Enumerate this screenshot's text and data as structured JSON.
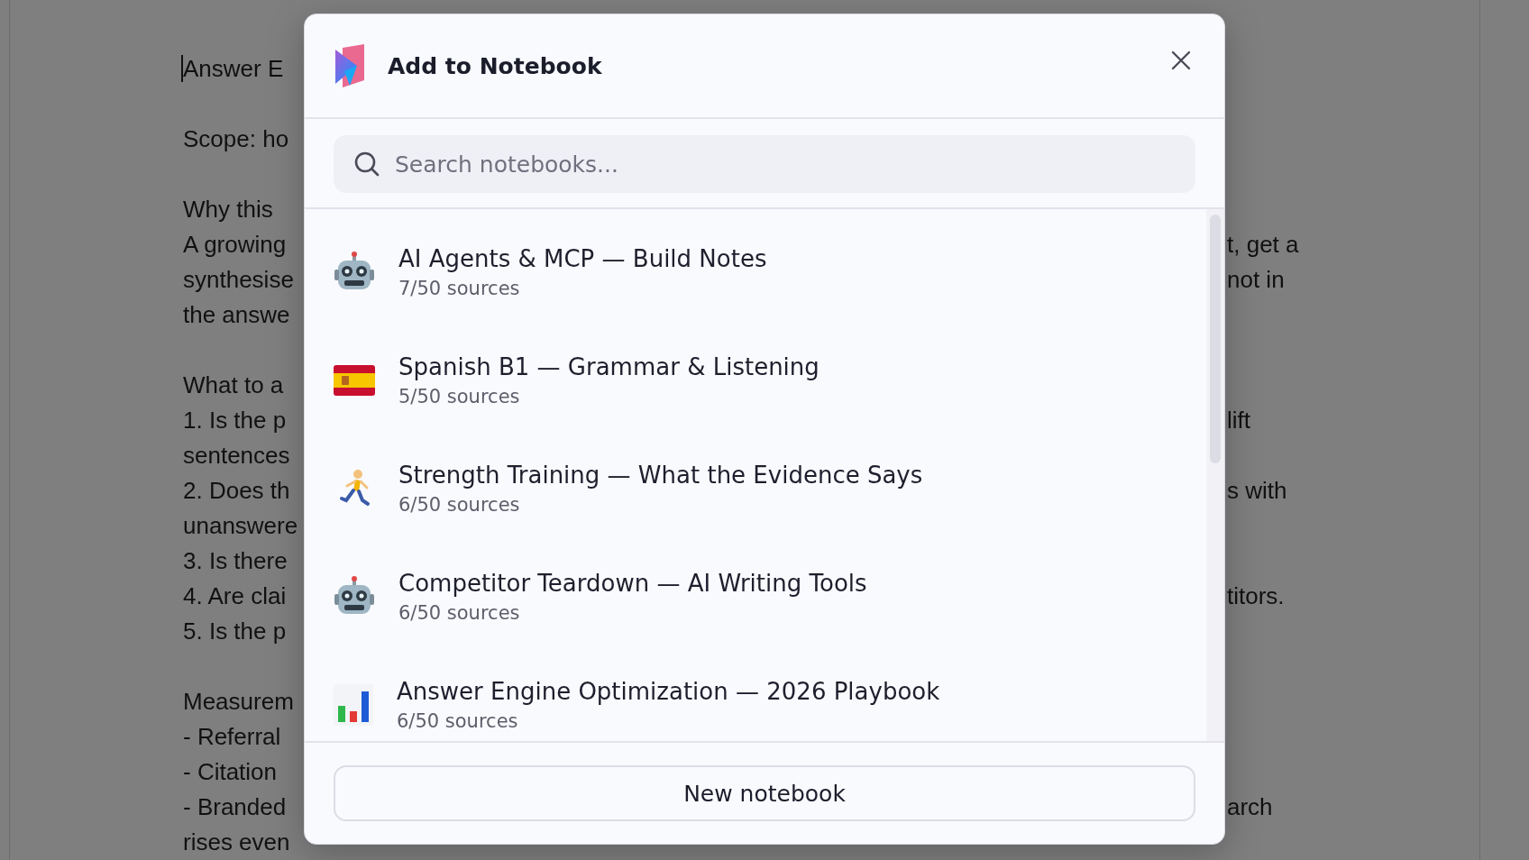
{
  "document": {
    "paragraphs": [
      {
        "lines": [
          {
            "left": "Answer E"
          }
        ]
      },
      {
        "lines": [
          {
            "left": "Scope: ho"
          }
        ]
      },
      {
        "lines": [
          {
            "left": "Why this"
          },
          {
            "left": "A growing",
            "right": "t, get a"
          },
          {
            "left": "synthesise",
            "right": "not in"
          },
          {
            "left": "the answe"
          }
        ]
      },
      {
        "lines": [
          {
            "left": "What to a"
          },
          {
            "left": "1. Is the p",
            "right": "lift"
          },
          {
            "left": "sentences"
          },
          {
            "left": "2. Does th",
            "right": "s with"
          },
          {
            "left": "unanswere"
          },
          {
            "left": "3. Is there"
          },
          {
            "left": "4. Are clai",
            "right": "titors."
          },
          {
            "left": "5. Is the p"
          }
        ]
      },
      {
        "lines": [
          {
            "left": "Measurem"
          },
          {
            "left": "- Referral"
          },
          {
            "left": "- Citation"
          },
          {
            "left": "- Branded",
            "right": "arch"
          },
          {
            "left": "rises even"
          }
        ]
      }
    ]
  },
  "dialog": {
    "title": "Add to Notebook",
    "search": {
      "placeholder": "Search notebooks..."
    },
    "notebooks": [
      {
        "kind": "robot",
        "name": "AI Agents & MCP — Build Notes",
        "sources": "7/50 sources"
      },
      {
        "kind": "flag",
        "name": "Spanish B1 — Grammar & Listening",
        "sources": "5/50 sources"
      },
      {
        "kind": "runner",
        "name": "Strength Training — What the Evidence Says",
        "sources": "6/50 sources"
      },
      {
        "kind": "robot",
        "name": "Competitor Teardown — AI Writing Tools",
        "sources": "6/50 sources"
      },
      {
        "kind": "chart",
        "name": "Answer Engine Optimization — 2026 Playbook",
        "sources": "6/50 sources"
      }
    ],
    "button": "New notebook"
  }
}
